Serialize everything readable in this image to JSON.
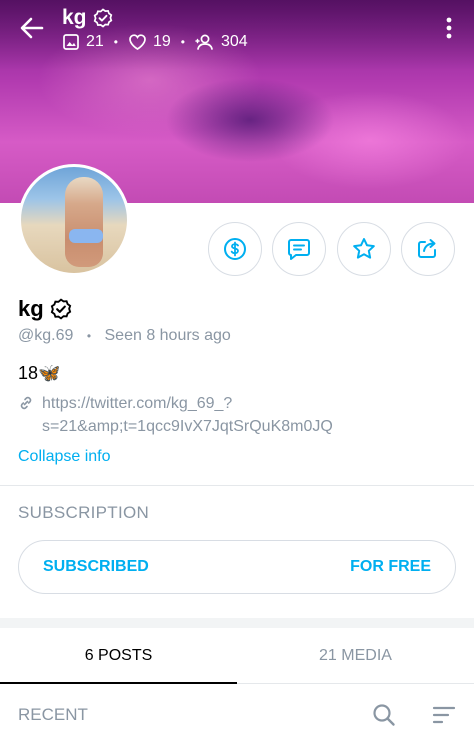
{
  "header": {
    "name": "kg",
    "stats": {
      "images": "21",
      "likes": "19",
      "fans": "304"
    }
  },
  "profile": {
    "name": "kg",
    "handle": "@kg.69",
    "seen": "Seen 8 hours ago",
    "bio": "18🦋",
    "link_line1": "https://twitter.com/kg_69_?",
    "link_line2": "s=21&amp;t=1qcc9IvX7JqtSrQuK8m0JQ",
    "collapse": "Collapse info"
  },
  "subscription": {
    "title": "SUBSCRIPTION",
    "status": "SUBSCRIBED",
    "price": "FOR FREE"
  },
  "tabs": [
    {
      "label": "6 POSTS"
    },
    {
      "label": "21 MEDIA"
    }
  ],
  "feed": {
    "sort_label": "RECENT"
  },
  "colors": {
    "accent": "#00aff0",
    "muted": "#8a96a3",
    "border": "#d8dde4"
  },
  "icons": [
    "back-arrow-icon",
    "verified-icon",
    "image-icon",
    "heart-icon",
    "fans-icon",
    "more-vertical-icon",
    "tip-dollar-icon",
    "message-icon",
    "star-icon",
    "share-icon",
    "link-icon",
    "search-icon",
    "sort-icon"
  ]
}
